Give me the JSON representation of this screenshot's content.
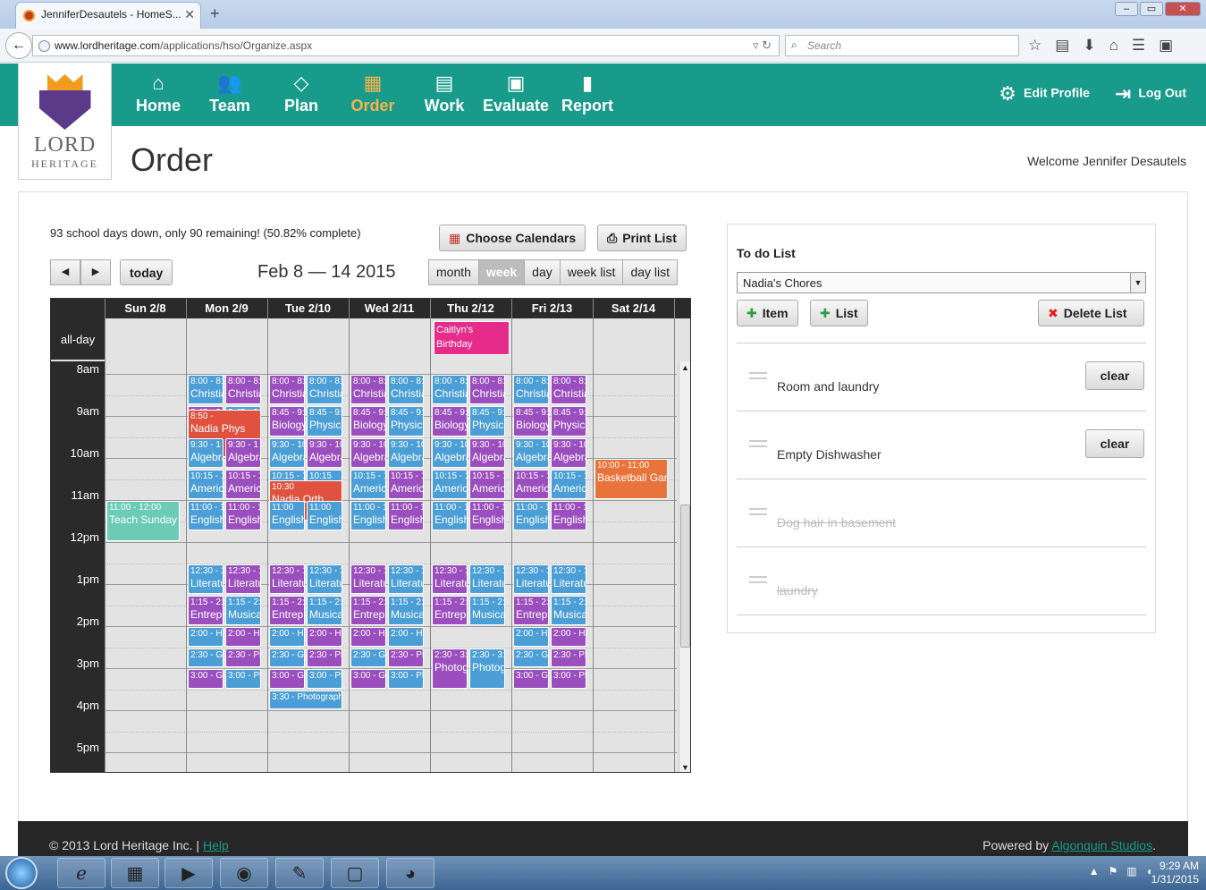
{
  "browser": {
    "tab_title": "JenniferDesautels - HomeS...",
    "url_host": "www.lordheritage.com",
    "url_path": "/applications/hso/Organize.aspx",
    "search_placeholder": "Search"
  },
  "brand": {
    "name": "LORD",
    "tagline": "HERITAGE"
  },
  "nav": [
    {
      "label": "Home",
      "icon": "home-icon",
      "glyph": "⌂",
      "active": false
    },
    {
      "label": "Team",
      "icon": "team-icon",
      "glyph": "👥",
      "active": false
    },
    {
      "label": "Plan",
      "icon": "plan-icon",
      "glyph": "◇",
      "active": false
    },
    {
      "label": "Order",
      "icon": "calendar-icon",
      "glyph": "▦",
      "active": true
    },
    {
      "label": "Work",
      "icon": "inbox-icon",
      "glyph": "▤",
      "active": false
    },
    {
      "label": "Evaluate",
      "icon": "grade-icon",
      "glyph": "▣",
      "active": false
    },
    {
      "label": "Report",
      "icon": "bar-chart-icon",
      "glyph": "▮",
      "active": false
    }
  ],
  "profile": {
    "edit_label": "Edit Profile",
    "logout_label": "Log Out"
  },
  "page": {
    "title": "Order",
    "welcome": "Welcome Jennifer Desautels"
  },
  "calendar": {
    "status": "93 school days down, only 90 remaining! (50.82% complete)",
    "choose_label": "Choose Calendars",
    "print_label": "Print List",
    "today_label": "today",
    "date_range": "Feb 8 — 14 2015",
    "views": [
      "month",
      "week",
      "day",
      "week list",
      "day list"
    ],
    "active_view": "week",
    "allday_label": "all-day",
    "days": [
      "Sun 2/8",
      "Mon 2/9",
      "Tue 2/10",
      "Wed 2/11",
      "Thu 2/12",
      "Fri 2/13",
      "Sat 2/14"
    ],
    "hours": [
      "8am",
      "9am",
      "10am",
      "11am",
      "12pm",
      "1pm",
      "2pm",
      "3pm",
      "4pm",
      "5pm"
    ],
    "allday_events": [
      {
        "day": 4,
        "title": "Caitlyn's Birthday",
        "color": "#e62b8a"
      }
    ],
    "events": [
      {
        "day": 1,
        "start": 8.0,
        "end": 8.75,
        "color": "b",
        "time": "8:00 - 8:",
        "title": "Christian"
      },
      {
        "day": 1,
        "start": 8.0,
        "end": 8.75,
        "color": "p",
        "time": "8:00 - 8:",
        "title": "Christian"
      },
      {
        "day": 1,
        "start": 8.75,
        "end": 9.5,
        "color": "p",
        "time": "8:45 - 9:",
        "title": "Biology"
      },
      {
        "day": 1,
        "start": 8.75,
        "end": 9.5,
        "color": "b",
        "time": "8:45 - 9:",
        "title": "Physical"
      },
      {
        "day": 1,
        "start": 8.83,
        "end": 10.0,
        "color": "r",
        "time": "8:50 -",
        "title": "Nadia Phys"
      },
      {
        "day": 1,
        "start": 9.5,
        "end": 10.25,
        "color": "b",
        "time": "9:30 - 1",
        "title": "Algebra"
      },
      {
        "day": 1,
        "start": 9.5,
        "end": 10.25,
        "color": "p",
        "time": "9:30 - 1",
        "title": "Algebra"
      },
      {
        "day": 1,
        "start": 10.25,
        "end": 11.0,
        "color": "b",
        "time": "10:15 - 1",
        "title": "American"
      },
      {
        "day": 1,
        "start": 10.25,
        "end": 11.0,
        "color": "p",
        "time": "10:15 - 1",
        "title": "American"
      },
      {
        "day": 1,
        "start": 11.0,
        "end": 11.75,
        "color": "b",
        "time": "11:00 - 1",
        "title": "English"
      },
      {
        "day": 1,
        "start": 11.0,
        "end": 11.75,
        "color": "p",
        "time": "11:00 - 1",
        "title": "English"
      },
      {
        "day": 1,
        "start": 12.5,
        "end": 13.25,
        "color": "b",
        "time": "12:30 - 1",
        "title": "Literature"
      },
      {
        "day": 1,
        "start": 12.5,
        "end": 13.25,
        "color": "p",
        "time": "12:30 - 1",
        "title": "Literature"
      },
      {
        "day": 1,
        "start": 13.25,
        "end": 14.0,
        "color": "p",
        "time": "1:15 - 2:",
        "title": "Entrepreneur"
      },
      {
        "day": 1,
        "start": 13.25,
        "end": 14.0,
        "color": "b",
        "time": "1:15 - 2:",
        "title": "Musical"
      },
      {
        "day": 1,
        "start": 14.0,
        "end": 14.5,
        "color": "b",
        "time": "2:00 - He",
        "title": ""
      },
      {
        "day": 1,
        "start": 14.0,
        "end": 14.5,
        "color": "p",
        "time": "2:00 - He",
        "title": ""
      },
      {
        "day": 1,
        "start": 14.5,
        "end": 15.0,
        "color": "b",
        "time": "2:30 - Ge",
        "title": ""
      },
      {
        "day": 1,
        "start": 14.5,
        "end": 15.0,
        "color": "p",
        "time": "2:30 - Ph",
        "title": ""
      },
      {
        "day": 1,
        "start": 15.0,
        "end": 15.5,
        "color": "p",
        "time": "3:00 - Ge",
        "title": ""
      },
      {
        "day": 1,
        "start": 15.0,
        "end": 15.5,
        "color": "b",
        "time": "3:00 - Ph",
        "title": ""
      },
      {
        "day": 2,
        "start": 8.0,
        "end": 8.75,
        "color": "p",
        "time": "8:00 - 8:",
        "title": "Christian"
      },
      {
        "day": 2,
        "start": 8.0,
        "end": 8.75,
        "color": "b",
        "time": "8:00 - 8:",
        "title": "Christian"
      },
      {
        "day": 2,
        "start": 8.75,
        "end": 9.5,
        "color": "p",
        "time": "8:45 - 9:",
        "title": "Biology"
      },
      {
        "day": 2,
        "start": 8.75,
        "end": 9.5,
        "color": "b",
        "time": "8:45 - 9:",
        "title": "Physical"
      },
      {
        "day": 2,
        "start": 9.5,
        "end": 10.25,
        "color": "b",
        "time": "9:30 - 10",
        "title": "Algebra"
      },
      {
        "day": 2,
        "start": 9.5,
        "end": 10.25,
        "color": "p",
        "time": "9:30 - 10",
        "title": "Algebra"
      },
      {
        "day": 2,
        "start": 10.25,
        "end": 11.0,
        "color": "b",
        "time": "10:15 - 1",
        "title": "American"
      },
      {
        "day": 2,
        "start": 10.25,
        "end": 11.0,
        "color": "b",
        "time": "10:15",
        "title": "American"
      },
      {
        "day": 2,
        "start": 10.5,
        "end": 11.5,
        "color": "r",
        "time": "10:30",
        "title": "Nadia Orth"
      },
      {
        "day": 2,
        "start": 11.0,
        "end": 11.75,
        "color": "b",
        "time": "11:00",
        "title": "English"
      },
      {
        "day": 2,
        "start": 11.0,
        "end": 11.75,
        "color": "b",
        "time": "11:00",
        "title": "English"
      },
      {
        "day": 2,
        "start": 12.5,
        "end": 13.25,
        "color": "p",
        "time": "12:30 - 1",
        "title": "Literature"
      },
      {
        "day": 2,
        "start": 12.5,
        "end": 13.25,
        "color": "b",
        "time": "12:30 - 1",
        "title": "Literature"
      },
      {
        "day": 2,
        "start": 13.25,
        "end": 14.0,
        "color": "p",
        "time": "1:15 - 2:",
        "title": "Entrepreneur"
      },
      {
        "day": 2,
        "start": 13.25,
        "end": 14.0,
        "color": "b",
        "time": "1:15 - 2:",
        "title": "Musical"
      },
      {
        "day": 2,
        "start": 14.0,
        "end": 14.5,
        "color": "b",
        "time": "2:00 - He",
        "title": ""
      },
      {
        "day": 2,
        "start": 14.0,
        "end": 14.5,
        "color": "p",
        "time": "2:00 - He",
        "title": ""
      },
      {
        "day": 2,
        "start": 14.5,
        "end": 15.0,
        "color": "b",
        "time": "2:30 - Ge",
        "title": ""
      },
      {
        "day": 2,
        "start": 14.5,
        "end": 15.0,
        "color": "p",
        "time": "2:30 - Ph",
        "title": ""
      },
      {
        "day": 2,
        "start": 15.0,
        "end": 15.5,
        "color": "p",
        "time": "3:00 - Ge",
        "title": ""
      },
      {
        "day": 2,
        "start": 15.0,
        "end": 15.5,
        "color": "b",
        "time": "3:00 - Ph",
        "title": ""
      },
      {
        "day": 2,
        "start": 15.5,
        "end": 16.0,
        "color": "b",
        "time": "3:30 - Photograph",
        "title": ""
      },
      {
        "day": 3,
        "start": 8.0,
        "end": 8.75,
        "color": "p",
        "time": "8:00 - 8:",
        "title": "Christian"
      },
      {
        "day": 3,
        "start": 8.0,
        "end": 8.75,
        "color": "b",
        "time": "8:00 - 8:",
        "title": "Christian"
      },
      {
        "day": 3,
        "start": 8.75,
        "end": 9.5,
        "color": "p",
        "time": "8:45 - 9:",
        "title": "Biology"
      },
      {
        "day": 3,
        "start": 8.75,
        "end": 9.5,
        "color": "b",
        "time": "8:45 - 9:",
        "title": "Physical"
      },
      {
        "day": 3,
        "start": 9.5,
        "end": 10.25,
        "color": "p",
        "time": "9:30 - 10",
        "title": "Algebra"
      },
      {
        "day": 3,
        "start": 9.5,
        "end": 10.25,
        "color": "b",
        "time": "9:30 - 10",
        "title": "Algebra"
      },
      {
        "day": 3,
        "start": 10.25,
        "end": 11.0,
        "color": "b",
        "time": "10:15 - 1",
        "title": "American"
      },
      {
        "day": 3,
        "start": 10.25,
        "end": 11.0,
        "color": "p",
        "time": "10:15 - 1",
        "title": "American"
      },
      {
        "day": 3,
        "start": 11.0,
        "end": 11.75,
        "color": "b",
        "time": "11:00 - 1",
        "title": "English"
      },
      {
        "day": 3,
        "start": 11.0,
        "end": 11.75,
        "color": "p",
        "time": "11:00 - 1",
        "title": "English"
      },
      {
        "day": 3,
        "start": 12.5,
        "end": 13.25,
        "color": "p",
        "time": "12:30 - 1",
        "title": "Literature"
      },
      {
        "day": 3,
        "start": 12.5,
        "end": 13.25,
        "color": "b",
        "time": "12:30 - 1",
        "title": "Literature"
      },
      {
        "day": 3,
        "start": 13.25,
        "end": 14.0,
        "color": "p",
        "time": "1:15 - 2:",
        "title": "Entrepreneur"
      },
      {
        "day": 3,
        "start": 13.25,
        "end": 14.0,
        "color": "b",
        "time": "1:15 - 2:",
        "title": "Musical"
      },
      {
        "day": 3,
        "start": 14.0,
        "end": 14.5,
        "color": "p",
        "time": "2:00 - He",
        "title": ""
      },
      {
        "day": 3,
        "start": 14.0,
        "end": 14.5,
        "color": "b",
        "time": "2:00 - He",
        "title": ""
      },
      {
        "day": 3,
        "start": 14.5,
        "end": 15.0,
        "color": "b",
        "time": "2:30 - Ge",
        "title": ""
      },
      {
        "day": 3,
        "start": 14.5,
        "end": 15.0,
        "color": "p",
        "time": "2:30 - Ph",
        "title": ""
      },
      {
        "day": 3,
        "start": 15.0,
        "end": 15.5,
        "color": "p",
        "time": "3:00 - Ge",
        "title": ""
      },
      {
        "day": 3,
        "start": 15.0,
        "end": 15.5,
        "color": "b",
        "time": "3:00 - Ph",
        "title": ""
      },
      {
        "day": 4,
        "start": 8.0,
        "end": 8.75,
        "color": "b",
        "time": "8:00 - 8:",
        "title": "Christian"
      },
      {
        "day": 4,
        "start": 8.0,
        "end": 8.75,
        "color": "p",
        "time": "8:00 - 8:",
        "title": "Christian"
      },
      {
        "day": 4,
        "start": 8.75,
        "end": 9.5,
        "color": "p",
        "time": "8:45 - 9:",
        "title": "Biology"
      },
      {
        "day": 4,
        "start": 8.75,
        "end": 9.5,
        "color": "b",
        "time": "8:45 - 9:",
        "title": "Physical"
      },
      {
        "day": 4,
        "start": 9.5,
        "end": 10.25,
        "color": "b",
        "time": "9:30 - 10",
        "title": "Algebra"
      },
      {
        "day": 4,
        "start": 9.5,
        "end": 10.25,
        "color": "p",
        "time": "9:30 - 10",
        "title": "Algebra"
      },
      {
        "day": 4,
        "start": 10.25,
        "end": 11.0,
        "color": "b",
        "time": "10:15 - 1",
        "title": "American"
      },
      {
        "day": 4,
        "start": 10.25,
        "end": 11.0,
        "color": "p",
        "time": "10:15 - 1",
        "title": "American"
      },
      {
        "day": 4,
        "start": 11.0,
        "end": 11.75,
        "color": "b",
        "time": "11:00 - 1",
        "title": "English"
      },
      {
        "day": 4,
        "start": 11.0,
        "end": 11.75,
        "color": "p",
        "time": "11:00 - 1",
        "title": "English"
      },
      {
        "day": 4,
        "start": 12.5,
        "end": 13.25,
        "color": "p",
        "time": "12:30 - 1",
        "title": "Literature"
      },
      {
        "day": 4,
        "start": 12.5,
        "end": 13.25,
        "color": "b",
        "time": "12:30 - 1",
        "title": "Literature"
      },
      {
        "day": 4,
        "start": 13.25,
        "end": 14.0,
        "color": "p",
        "time": "1:15 - 2:",
        "title": "Entrepreneur"
      },
      {
        "day": 4,
        "start": 13.25,
        "end": 14.0,
        "color": "b",
        "time": "1:15 - 2:",
        "title": "Musical"
      },
      {
        "day": 4,
        "start": 14.5,
        "end": 15.5,
        "color": "p",
        "time": "2:30 - 3:",
        "title": "Photography"
      },
      {
        "day": 4,
        "start": 14.5,
        "end": 15.5,
        "color": "b",
        "time": "2:30 - 3:",
        "title": "Photography"
      },
      {
        "day": 5,
        "start": 8.0,
        "end": 8.75,
        "color": "b",
        "time": "8:00 - 8:",
        "title": "Christian"
      },
      {
        "day": 5,
        "start": 8.0,
        "end": 8.75,
        "color": "p",
        "time": "8:00 - 8:",
        "title": "Christian"
      },
      {
        "day": 5,
        "start": 8.75,
        "end": 9.5,
        "color": "p",
        "time": "8:45 - 9:",
        "title": "Biology"
      },
      {
        "day": 5,
        "start": 8.75,
        "end": 9.5,
        "color": "p",
        "time": "8:45 - 9:",
        "title": "Physical"
      },
      {
        "day": 5,
        "start": 9.5,
        "end": 10.25,
        "color": "b",
        "time": "9:30 - 10",
        "title": "Algebra"
      },
      {
        "day": 5,
        "start": 9.5,
        "end": 10.25,
        "color": "p",
        "time": "9:30 - 10",
        "title": "Algebra"
      },
      {
        "day": 5,
        "start": 10.25,
        "end": 11.0,
        "color": "p",
        "time": "10:15 - 1",
        "title": "American"
      },
      {
        "day": 5,
        "start": 10.25,
        "end": 11.0,
        "color": "b",
        "time": "10:15 - 1",
        "title": "American"
      },
      {
        "day": 5,
        "start": 11.0,
        "end": 11.75,
        "color": "b",
        "time": "11:00 - 1",
        "title": "English"
      },
      {
        "day": 5,
        "start": 11.0,
        "end": 11.75,
        "color": "p",
        "time": "11:00 - 1",
        "title": "English"
      },
      {
        "day": 5,
        "start": 12.5,
        "end": 13.25,
        "color": "b",
        "time": "12:30 - 1",
        "title": "Literature"
      },
      {
        "day": 5,
        "start": 12.5,
        "end": 13.25,
        "color": "b",
        "time": "12:30 - 1",
        "title": "Literature"
      },
      {
        "day": 5,
        "start": 13.25,
        "end": 14.0,
        "color": "p",
        "time": "1:15 - 2:",
        "title": "Entrepreneur"
      },
      {
        "day": 5,
        "start": 13.25,
        "end": 14.0,
        "color": "b",
        "time": "1:15 - 2:",
        "title": "Musical"
      },
      {
        "day": 5,
        "start": 14.0,
        "end": 14.5,
        "color": "b",
        "time": "2:00 - He",
        "title": ""
      },
      {
        "day": 5,
        "start": 14.0,
        "end": 14.5,
        "color": "p",
        "time": "2:00 - He",
        "title": ""
      },
      {
        "day": 5,
        "start": 14.5,
        "end": 15.0,
        "color": "b",
        "time": "2:30 - Ge",
        "title": ""
      },
      {
        "day": 5,
        "start": 14.5,
        "end": 15.0,
        "color": "p",
        "time": "2:30 - Ph",
        "title": ""
      },
      {
        "day": 5,
        "start": 15.0,
        "end": 15.5,
        "color": "p",
        "time": "3:00 - Ge",
        "title": ""
      },
      {
        "day": 5,
        "start": 15.0,
        "end": 15.5,
        "color": "p",
        "time": "3:00 - Ph",
        "title": ""
      },
      {
        "day": 0,
        "start": 11.0,
        "end": 12.0,
        "color": "g",
        "time": "11:00 - 12:00",
        "title": "Teach Sunday"
      },
      {
        "day": 6,
        "start": 10.0,
        "end": 11.0,
        "color": "o",
        "time": "10:00 - 11:00",
        "title": "Basketball Game"
      }
    ]
  },
  "todo": {
    "title": "To do List",
    "selected_list": "Nadia's Chores",
    "item_btn": "Item",
    "list_btn": "List",
    "delete_btn": "Delete List",
    "clear_label": "clear",
    "items": [
      {
        "label": "Room and laundry",
        "done": false
      },
      {
        "label": "Empty Dishwasher",
        "done": false
      },
      {
        "label": "Dog hair in basement",
        "done": true
      },
      {
        "label": "laundry",
        "done": true
      }
    ]
  },
  "footer": {
    "copyright": "© 2013 Lord Heritage Inc.",
    "sep": "|",
    "help": "Help",
    "powered": "Powered by",
    "company": "Algonquin Studios",
    "period": "."
  },
  "taskbar": {
    "time": "9:29 AM",
    "date": "1/31/2015"
  }
}
